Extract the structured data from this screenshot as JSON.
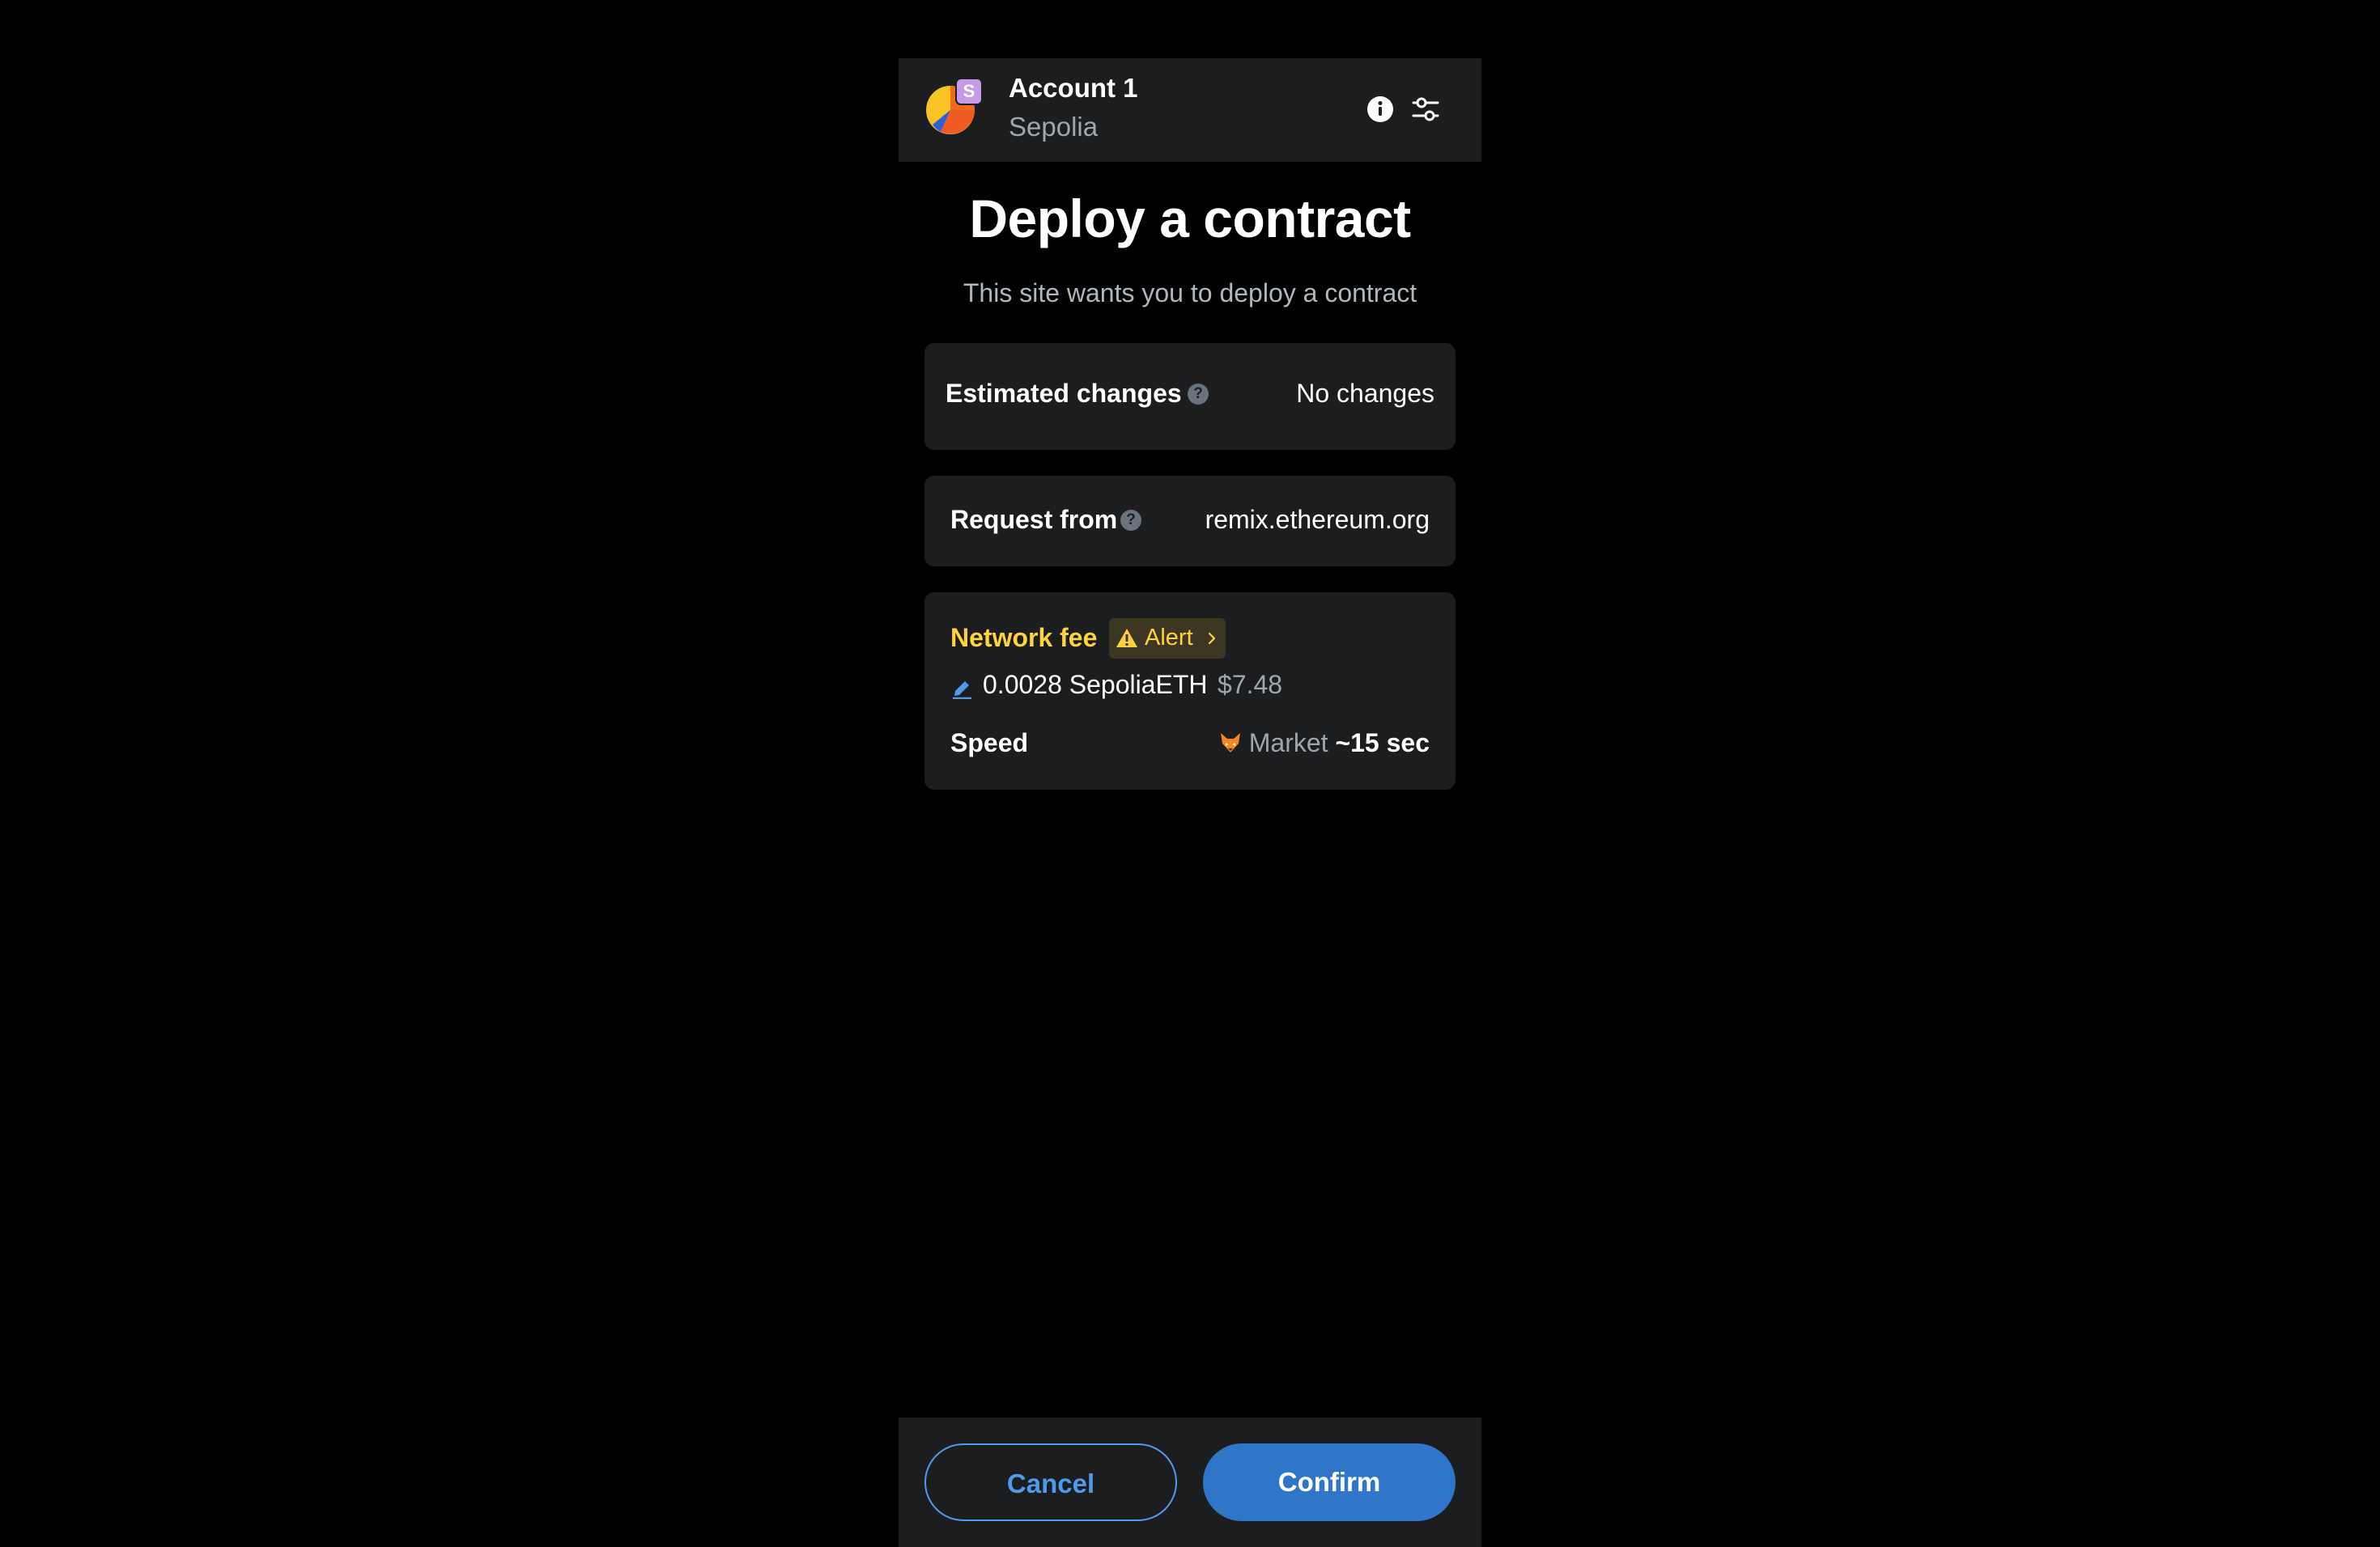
{
  "header": {
    "account_name": "Account 1",
    "network": "Sepolia",
    "network_badge_letter": "S"
  },
  "page": {
    "title": "Deploy a contract",
    "subtitle": "This site wants you to deploy a contract"
  },
  "estimated_changes": {
    "label": "Estimated changes",
    "value": "No changes"
  },
  "request": {
    "label": "Request from",
    "value": "remix.ethereum.org"
  },
  "network_fee": {
    "label": "Network fee",
    "alert_label": "Alert",
    "amount": "0.0028 SepoliaETH",
    "fiat": "$7.48",
    "speed_label": "Speed",
    "speed_option": "Market",
    "speed_time": "~15 sec"
  },
  "actions": {
    "cancel_label": "Cancel",
    "confirm_label": "Confirm"
  },
  "colors": {
    "accent": "#2f76c9",
    "alert": "#ffd33d",
    "card": "#1c1d1f"
  }
}
